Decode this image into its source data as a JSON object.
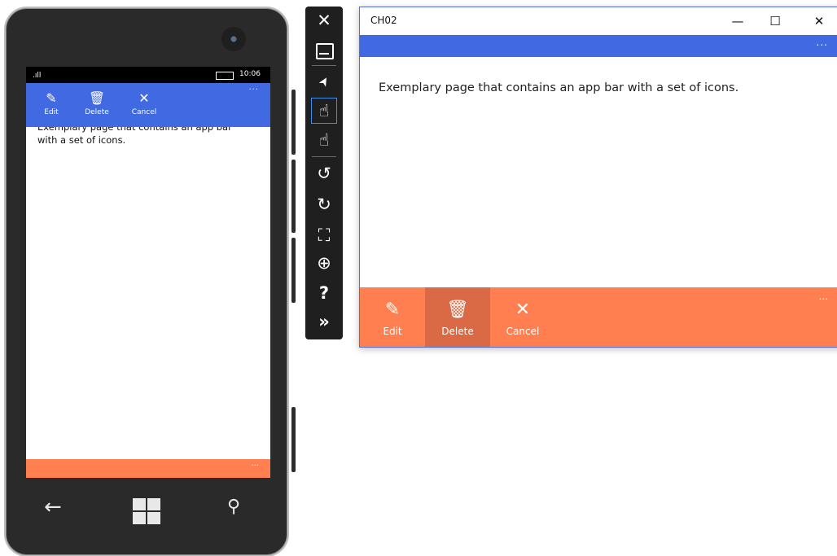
{
  "phone": {
    "status": {
      "signal": ".ıll",
      "time": "10:06"
    },
    "appbar": {
      "more": "...",
      "buttons": [
        {
          "icon": "✎",
          "label": "Edit"
        },
        {
          "icon": "🗑",
          "label": "Delete"
        },
        {
          "icon": "✕",
          "label": "Cancel"
        }
      ]
    },
    "content": {
      "text": "Exemplary page that contains an app bar with a set of icons."
    },
    "bottom_bar": {
      "more": "..."
    },
    "nav": {
      "back": "←",
      "search": "⚲"
    }
  },
  "emulator_toolbar": {
    "tools": [
      {
        "icon": "✕",
        "name": "close-icon"
      },
      {
        "icon": "▁",
        "name": "minimize-icon"
      },
      {
        "icon": "➤",
        "name": "pointer-icon"
      },
      {
        "icon": "☝",
        "name": "single-touch-icon"
      },
      {
        "icon": "☝",
        "name": "multi-touch-icon"
      },
      {
        "icon": "↺",
        "name": "rotate-left-icon"
      },
      {
        "icon": "↻",
        "name": "rotate-right-icon"
      },
      {
        "icon": "⛶",
        "name": "fit-to-screen-icon"
      },
      {
        "icon": "⊕",
        "name": "zoom-icon"
      },
      {
        "icon": "?",
        "name": "help-icon"
      },
      {
        "icon": "»",
        "name": "more-tools-icon"
      }
    ]
  },
  "window": {
    "title": "CH02",
    "controls": {
      "minimize": "—",
      "maximize": "☐",
      "close": "✕"
    },
    "topbar": {
      "more": "..."
    },
    "content": {
      "text": "Exemplary page that contains an app bar with a set of icons."
    },
    "bottombar": {
      "more": "...",
      "buttons": [
        {
          "icon": "✎",
          "label": "Edit"
        },
        {
          "icon": "🗑",
          "label": "Delete"
        },
        {
          "icon": "✕",
          "label": "Cancel"
        }
      ]
    }
  },
  "colors": {
    "accent_blue": "#4169e1",
    "accent_coral": "#ff7f50",
    "pressed_coral": "#d96a45"
  }
}
